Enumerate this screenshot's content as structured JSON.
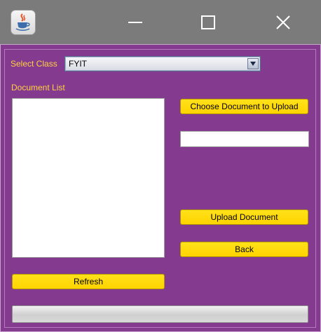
{
  "window": {
    "app_icon": "java-cup-icon",
    "controls": [
      "minimize-icon",
      "maximize-icon",
      "close-icon"
    ]
  },
  "class_selector": {
    "label": "Select Class",
    "selected": "FYIT"
  },
  "document_list": {
    "label": "Document List",
    "items": []
  },
  "buttons": {
    "choose": "Choose Document to Upload",
    "upload": "Upload Document",
    "back": "Back",
    "refresh": "Refresh"
  },
  "file_path_field": {
    "value": ""
  },
  "progress": {
    "value": 0
  },
  "colors": {
    "background": "#843a8f",
    "label_text": "#ffd23f",
    "button": "#ffd800"
  }
}
